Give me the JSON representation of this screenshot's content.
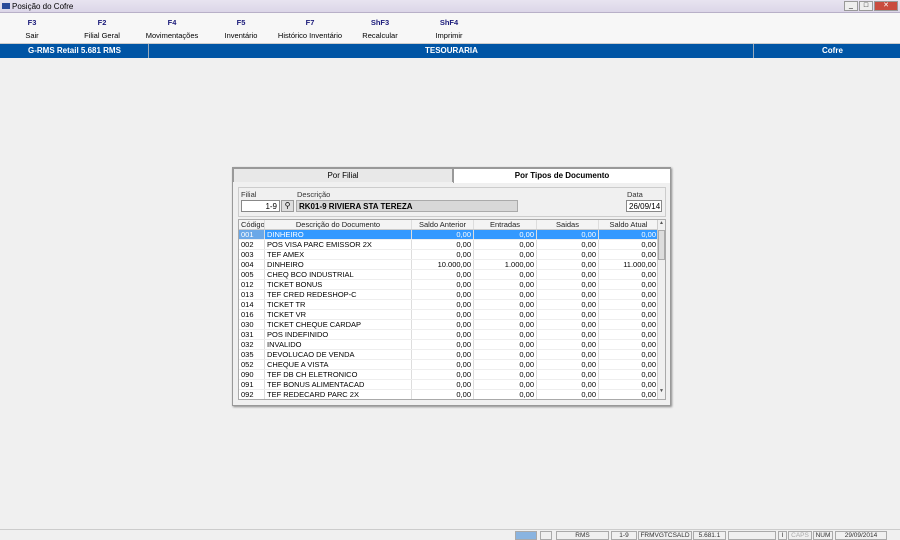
{
  "window": {
    "title": "Posição do Cofre"
  },
  "toolbar": [
    {
      "key": "F3",
      "label": "Sair"
    },
    {
      "key": "F2",
      "label": "Filial Geral"
    },
    {
      "key": "F4",
      "label": "Movimentações"
    },
    {
      "key": "F5",
      "label": "Inventário"
    },
    {
      "key": "F7",
      "label": "Histórico Inventário"
    },
    {
      "key": "ShF3",
      "label": "Recalcular"
    },
    {
      "key": "ShF4",
      "label": "Imprimir"
    }
  ],
  "banner": {
    "app": "G-RMS Retail 5.681 RMS",
    "module": "TESOURARIA",
    "screen": "Cofre"
  },
  "tabs": [
    "Por Filial",
    "Por Tipos de Documento"
  ],
  "form": {
    "filial_label": "Filial",
    "filial": "1-9",
    "descricao_label": "Descrição",
    "descricao": "RK01-9 RIVIERA STA TEREZA",
    "data_label": "Data",
    "data": "26/09/14"
  },
  "columns": [
    "Código",
    "Descrição do Documento",
    "Saldo Anterior",
    "Entradas",
    "Saidas",
    "Saldo Atual"
  ],
  "rows": [
    [
      "001",
      "DINHEIRO",
      "0,00",
      "0,00",
      "0,00",
      "0,00"
    ],
    [
      "002",
      "POS VISA PARC EMISSOR  2X",
      "0,00",
      "0,00",
      "0,00",
      "0,00"
    ],
    [
      "003",
      "TEF AMEX",
      "0,00",
      "0,00",
      "0,00",
      "0,00"
    ],
    [
      "004",
      "DINHEIRO",
      "10.000,00",
      "1.000,00",
      "0,00",
      "11.000,00"
    ],
    [
      "005",
      "CHEQ BCO INDUSTRIAL",
      "0,00",
      "0,00",
      "0,00",
      "0,00"
    ],
    [
      "012",
      "TICKET BONUS",
      "0,00",
      "0,00",
      "0,00",
      "0,00"
    ],
    [
      "013",
      "TEF CRED REDESHOP-C",
      "0,00",
      "0,00",
      "0,00",
      "0,00"
    ],
    [
      "014",
      "TICKET TR",
      "0,00",
      "0,00",
      "0,00",
      "0,00"
    ],
    [
      "016",
      "TICKET VR",
      "0,00",
      "0,00",
      "0,00",
      "0,00"
    ],
    [
      "030",
      "TICKET CHEQUE CARDAP",
      "0,00",
      "0,00",
      "0,00",
      "0,00"
    ],
    [
      "031",
      "POS INDEFINIDO",
      "0,00",
      "0,00",
      "0,00",
      "0,00"
    ],
    [
      "032",
      "INVALIDO",
      "0,00",
      "0,00",
      "0,00",
      "0,00"
    ],
    [
      "035",
      "DEVOLUCAO DE VENDA",
      "0,00",
      "0,00",
      "0,00",
      "0,00"
    ],
    [
      "052",
      "CHEQUE A VISTA",
      "0,00",
      "0,00",
      "0,00",
      "0,00"
    ],
    [
      "090",
      "TEF DB CH ELETRONICO",
      "0,00",
      "0,00",
      "0,00",
      "0,00"
    ],
    [
      "091",
      "TEF BONUS ALIMENTACAD",
      "0,00",
      "0,00",
      "0,00",
      "0,00"
    ],
    [
      "092",
      "TEF REDECARD PARC 2X",
      "0,00",
      "0,00",
      "0,00",
      "0,00"
    ]
  ],
  "status": {
    "user": "RMS",
    "filial": "1-9",
    "program": "FRMVGTCSALD",
    "version": "5.681.1",
    "ins": "I",
    "caps": "CAPS",
    "num": "NUM",
    "date": "29/09/2014"
  }
}
